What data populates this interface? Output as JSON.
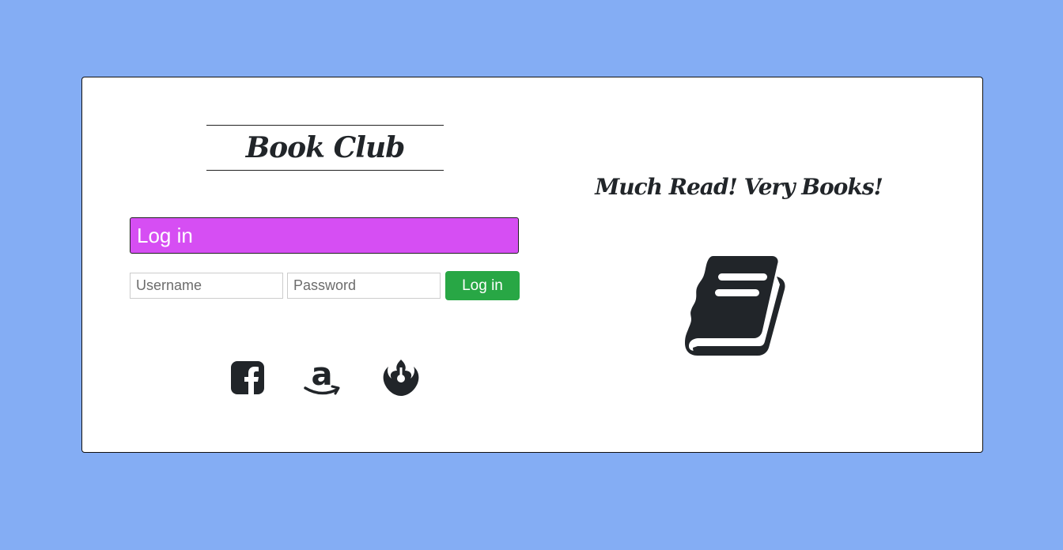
{
  "app": {
    "title": "Book Club",
    "tagline": "Much Read! Very Books!"
  },
  "login": {
    "header": "Log in",
    "username_placeholder": "Username",
    "password_placeholder": "Password",
    "submit_label": "Log in"
  },
  "social": {
    "icons": [
      "facebook-icon",
      "amazon-icon",
      "rebel-icon"
    ]
  },
  "colors": {
    "background": "#84adf4",
    "login_header": "#d64ef3",
    "login_button": "#28a745",
    "icon": "#212529"
  },
  "illustration": {
    "icon": "book-icon"
  }
}
